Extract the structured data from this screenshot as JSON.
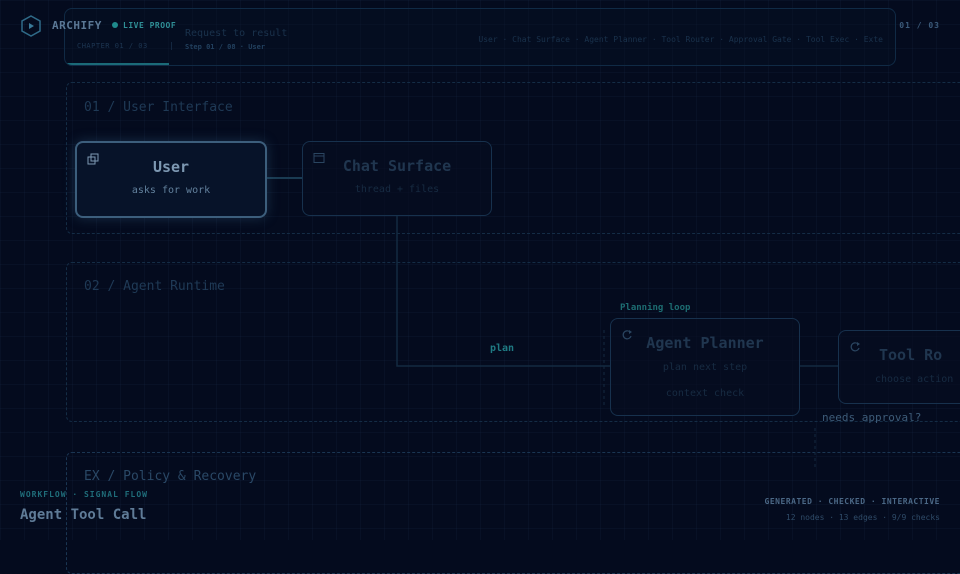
{
  "header": {
    "brand": "ARCHIFY",
    "live_label": "LIVE PROOF",
    "page_counter": "01 / 03"
  },
  "top_panel": {
    "title": "Request to result",
    "chapter": "CHAPTER 01 / 03",
    "separator": "|",
    "step": "Step 01 / 08 · User",
    "path": "User · Chat Surface · Agent Planner · Tool Router · Approval Gate · Tool Exec · Exte",
    "progress": 0.125
  },
  "sections": [
    {
      "title": "01 / User Interface"
    },
    {
      "title": "02 / Agent Runtime"
    },
    {
      "title": "EX / Policy & Recovery"
    }
  ],
  "nodes": {
    "user": {
      "title": "User",
      "subtitle": "asks for work",
      "icon": "window-stack-icon"
    },
    "chat_surface": {
      "title": "Chat Surface",
      "subtitle": "thread + files",
      "icon": "browser-window-icon"
    },
    "agent_planner": {
      "title": "Agent Planner",
      "subtitle": "plan next step",
      "subtitle2": "context check",
      "icon": "loop-arrow-icon"
    },
    "tool_router": {
      "title": "Tool Ro",
      "subtitle": "choose action",
      "icon": "loop-arrow-icon"
    }
  },
  "edge_labels": {
    "plan": "plan",
    "planning_loop": "Planning loop",
    "needs_approval": "needs approval?"
  },
  "footer": {
    "kicker": "WORKFLOW · SIGNAL FLOW",
    "title": "Agent Tool Call",
    "status": "GENERATED · CHECKED · INTERACTIVE",
    "stats": "12 nodes · 13 edges · 9/9 checks"
  },
  "colors": {
    "background": "#040b1e",
    "accent": "#1f8a8c",
    "active_border": "#3c5e7c"
  }
}
